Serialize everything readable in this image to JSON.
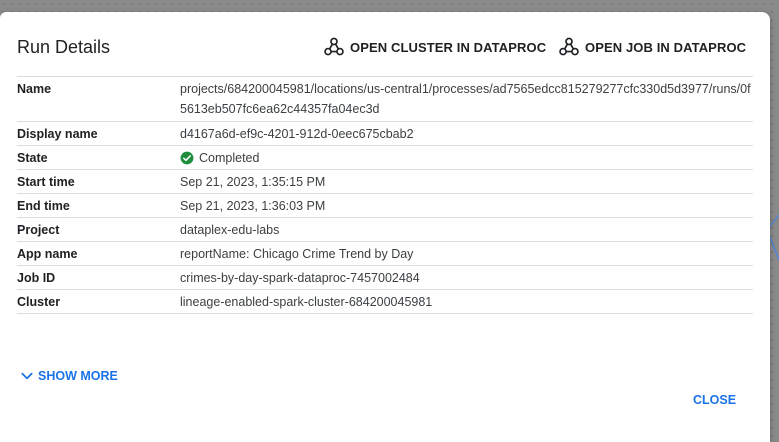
{
  "dialog": {
    "title": "Run Details",
    "open_cluster_label": "OPEN CLUSTER IN DATAPROC",
    "open_job_label": "OPEN JOB IN DATAPROC",
    "show_more_label": "SHOW MORE",
    "close_label": "CLOSE"
  },
  "details": {
    "name": {
      "label": "Name",
      "value": "projects/684200045981/locations/us-central1/processes/ad7565edcc815279277cfc330d5d3977/runs/0f5613eb507fc6ea62c44357fa04ec3d"
    },
    "display_name": {
      "label": "Display name",
      "value": "d4167a6d-ef9c-4201-912d-0eec675cbab2"
    },
    "state": {
      "label": "State",
      "value": "Completed"
    },
    "start_time": {
      "label": "Start time",
      "value": "Sep 21, 2023, 1:35:15 PM"
    },
    "end_time": {
      "label": "End time",
      "value": "Sep 21, 2023, 1:36:03 PM"
    },
    "project": {
      "label": "Project",
      "value": "dataplex-edu-labs"
    },
    "app_name": {
      "label": "App name",
      "value": "reportName: Chicago Crime Trend by Day"
    },
    "job_id": {
      "label": "Job ID",
      "value": "crimes-by-day-spark-dataproc-7457002484"
    },
    "cluster": {
      "label": "Cluster",
      "value": "lineage-enabled-spark-cluster-684200045981"
    }
  },
  "colors": {
    "accent": "#1a73e8",
    "success": "#1e8e3e"
  },
  "icons": {
    "dataproc": "dataproc-icon",
    "state": "check-circle-icon",
    "expand": "chevron-down-icon"
  }
}
